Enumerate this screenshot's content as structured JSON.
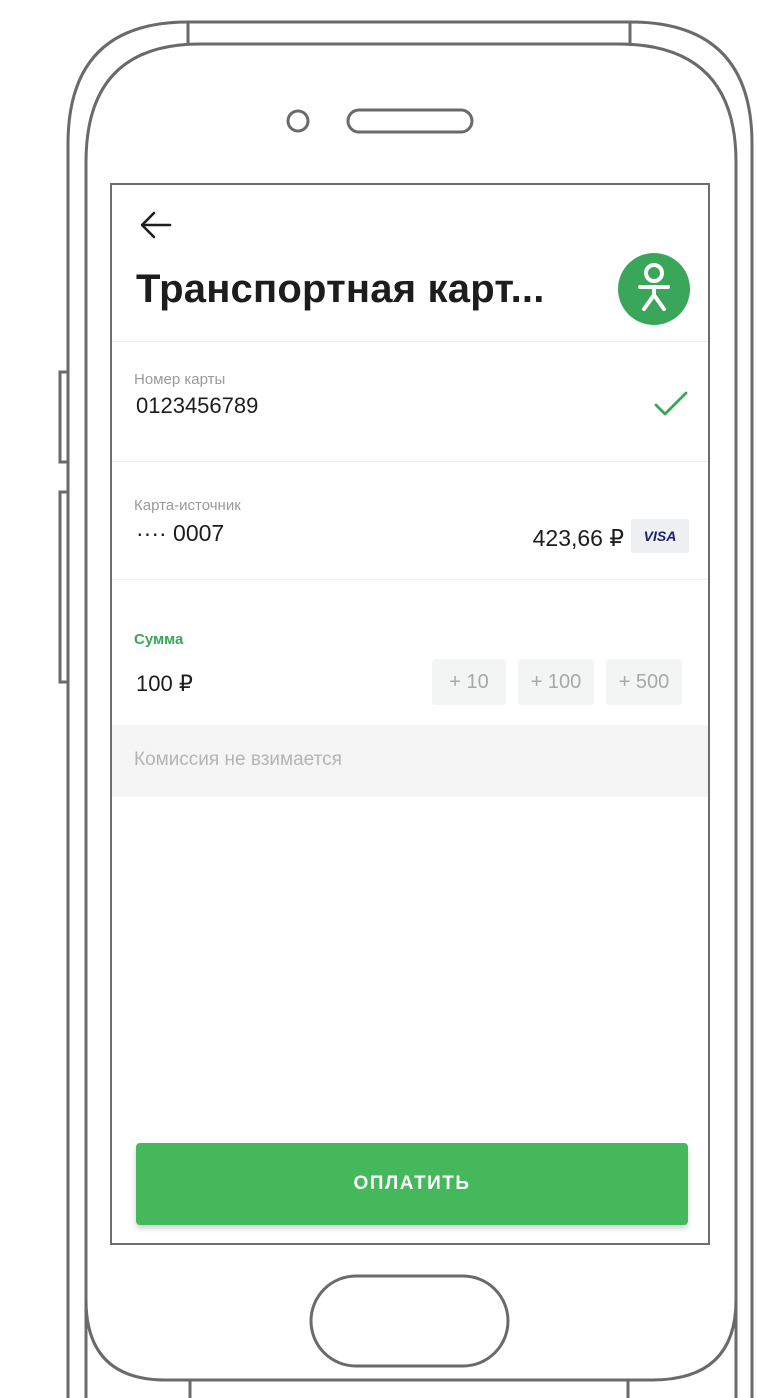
{
  "header": {
    "back_icon": "arrow-left-icon",
    "title": "Транспортная карт...",
    "logo_icon": "sberbank-person-logo-icon"
  },
  "card_number": {
    "label": "Номер карты",
    "value": "0123456789",
    "status_icon": "checkmark-icon"
  },
  "source_card": {
    "label": "Карта-источник",
    "value": "···· 0007",
    "balance": "423,66 ₽",
    "payment_system": "VISA"
  },
  "amount": {
    "label": "Сумма",
    "value": "100 ₽",
    "quick_adds": [
      "+ 10",
      "+ 100",
      "+ 500"
    ]
  },
  "commission": {
    "text": "Комиссия не взимается"
  },
  "pay_button": {
    "label": "ОПЛАТИТЬ"
  },
  "colors": {
    "accent_green": "#45b85c",
    "label_green": "#3aa65a",
    "text_dark": "#1d1d1d",
    "text_muted": "#9a9a9a",
    "visa_blue": "#1a1f71"
  }
}
